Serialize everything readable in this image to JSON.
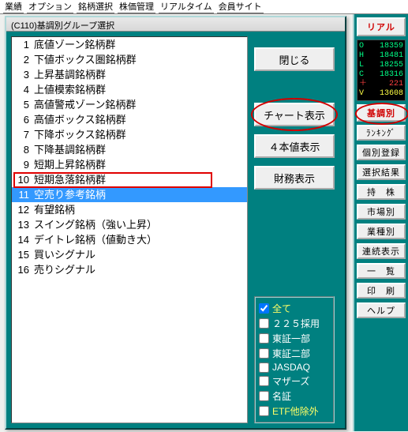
{
  "topmenu": [
    "業績",
    "オプション",
    "銘柄選択",
    "株価管理",
    "リアルタイム",
    "会員サイト"
  ],
  "dialog_title": "(C110)基調別グループ選択",
  "list": [
    {
      "n": 1,
      "t": "底値ゾーン銘柄群"
    },
    {
      "n": 2,
      "t": "下値ボックス圏銘柄群"
    },
    {
      "n": 3,
      "t": "上昇基調銘柄群"
    },
    {
      "n": 4,
      "t": "上値模索銘柄群"
    },
    {
      "n": 5,
      "t": "高値警戒ゾーン銘柄群"
    },
    {
      "n": 6,
      "t": "高値ボックス銘柄群"
    },
    {
      "n": 7,
      "t": "下降ボックス銘柄群"
    },
    {
      "n": 8,
      "t": "下降基調銘柄群"
    },
    {
      "n": 9,
      "t": "短期上昇銘柄群"
    },
    {
      "n": 10,
      "t": "短期急落銘柄群"
    },
    {
      "n": 11,
      "t": "空売り参考銘柄"
    },
    {
      "n": 12,
      "t": "有望銘柄"
    },
    {
      "n": 13,
      "t": "スイング銘柄（強い上昇）"
    },
    {
      "n": 14,
      "t": "デイトレ銘柄（値動き大）"
    },
    {
      "n": 15,
      "t": "買いシグナル"
    },
    {
      "n": 16,
      "t": "売りシグナル"
    }
  ],
  "selected_index": 10,
  "buttons": {
    "close": "閉じる",
    "chart": "チャート表示",
    "four": "４本値表示",
    "fin": "財務表示"
  },
  "checks": [
    {
      "label": "全て",
      "checked": true,
      "y": true
    },
    {
      "label": "２２５採用",
      "checked": false
    },
    {
      "label": "東証一部",
      "checked": false
    },
    {
      "label": "東証二部",
      "checked": false
    },
    {
      "label": "JASDAQ",
      "checked": false
    },
    {
      "label": "マザーズ",
      "checked": false
    },
    {
      "label": "名証",
      "checked": false
    },
    {
      "label": "ETF他除外",
      "checked": false,
      "y": true
    }
  ],
  "sidebar": {
    "real": "リアル",
    "kicho": "基調別",
    "items": [
      "ﾗﾝｷﾝｸﾞ",
      "個別登録",
      "選択結果",
      "持　株",
      "市場別",
      "業種別",
      "連続表示",
      "一　覧",
      "印　刷",
      "ヘルプ"
    ]
  },
  "ticker": [
    {
      "k": "O",
      "v": "18359",
      "c": "g"
    },
    {
      "k": "H",
      "v": "18481",
      "c": "g"
    },
    {
      "k": "L",
      "v": "18255",
      "c": "g"
    },
    {
      "k": "C",
      "v": "18316",
      "c": "g"
    },
    {
      "k": "＋",
      "v": "221",
      "c": "r"
    },
    {
      "k": "V",
      "v": "13608",
      "c": "y"
    }
  ]
}
